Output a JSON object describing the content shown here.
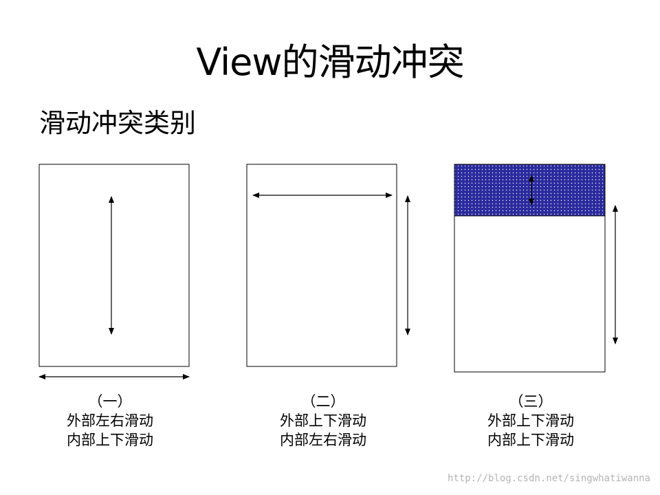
{
  "slide": {
    "title": "View的滑动冲突",
    "subtitle": "滑动冲突类别"
  },
  "cases": [
    {
      "number": "（一）",
      "outer": "外部左右滑动",
      "inner": "内部上下滑动"
    },
    {
      "number": "（二）",
      "outer": "外部上下滑动",
      "inner": "内部左右滑动"
    },
    {
      "number": "（三）",
      "outer": "外部上下滑动",
      "inner": "内部上下滑动"
    }
  ],
  "colors": {
    "inner_view_fill": "#2b2b9e",
    "dot_color": "#ffffff",
    "stroke": "#000000"
  },
  "watermark": "http://blog.csdn.net/singwhatiwanna"
}
